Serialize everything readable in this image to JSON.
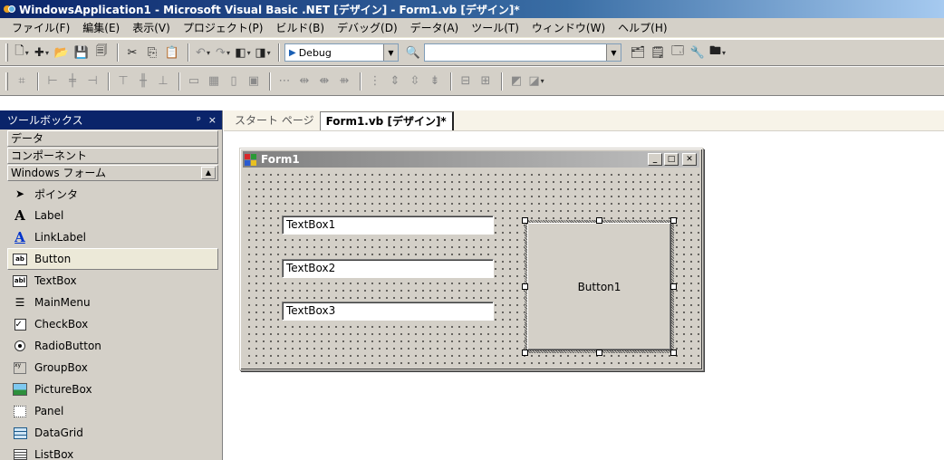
{
  "window": {
    "title": "WindowsApplication1 - Microsoft Visual Basic .NET [デザイン] - Form1.vb [デザイン]*"
  },
  "menu": [
    "ファイル(F)",
    "編集(E)",
    "表示(V)",
    "プロジェクト(P)",
    "ビルド(B)",
    "デバッグ(D)",
    "データ(A)",
    "ツール(T)",
    "ウィンドウ(W)",
    "ヘルプ(H)"
  ],
  "toolbar": {
    "config": "Debug",
    "find": ""
  },
  "toolbox": {
    "title": "ツールボックス",
    "pin_glyph": "ᵖ",
    "close_glyph": "×",
    "tabs": {
      "data": "データ",
      "components": "コンポーネント",
      "forms": "Windows フォーム"
    },
    "items": [
      {
        "label": "ポインタ",
        "icon": "pointer-icon"
      },
      {
        "label": "Label",
        "icon": "label-icon"
      },
      {
        "label": "LinkLabel",
        "icon": "linklabel-icon"
      },
      {
        "label": "Button",
        "icon": "button-icon",
        "selected": true
      },
      {
        "label": "TextBox",
        "icon": "textbox-icon"
      },
      {
        "label": "MainMenu",
        "icon": "mainmenu-icon"
      },
      {
        "label": "CheckBox",
        "icon": "checkbox-icon"
      },
      {
        "label": "RadioButton",
        "icon": "radiobutton-icon"
      },
      {
        "label": "GroupBox",
        "icon": "groupbox-icon"
      },
      {
        "label": "PictureBox",
        "icon": "picturebox-icon"
      },
      {
        "label": "Panel",
        "icon": "panel-icon"
      },
      {
        "label": "DataGrid",
        "icon": "datagrid-icon"
      },
      {
        "label": "ListBox",
        "icon": "listbox-icon"
      }
    ]
  },
  "tabs": {
    "start": "スタート ページ",
    "form": "Form1.vb [デザイン]*"
  },
  "form": {
    "title": "Form1",
    "textboxes": [
      "TextBox1",
      "TextBox2",
      "TextBox3"
    ],
    "button": "Button1"
  }
}
